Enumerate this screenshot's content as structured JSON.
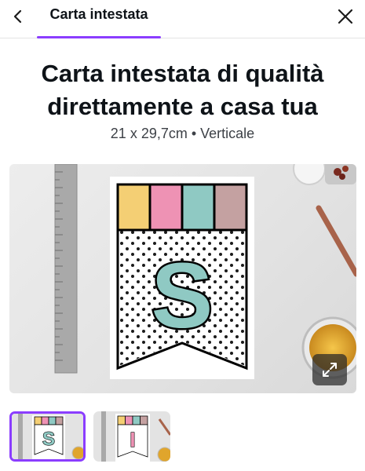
{
  "header": {
    "tab_label": "Carta intestata",
    "accent_color": "#8b3dff",
    "back_icon": "chevron-left-icon",
    "close_icon": "close-icon"
  },
  "main": {
    "headline": "Carta intestata di qualità direttamente a casa tua",
    "subtitle": "21 x 29,7cm • Verticale"
  },
  "preview": {
    "banner_letter": "S",
    "stripe_colors": [
      "#f4cf74",
      "#ee92b4",
      "#8fc9c3",
      "#c4a1a1"
    ],
    "expand_icon": "expand-icon"
  },
  "thumbnails": [
    {
      "letter": "S",
      "letter_color": "#8fc9c3",
      "selected": true
    },
    {
      "letter": "I",
      "letter_color": "#ee92b4",
      "selected": false
    }
  ]
}
